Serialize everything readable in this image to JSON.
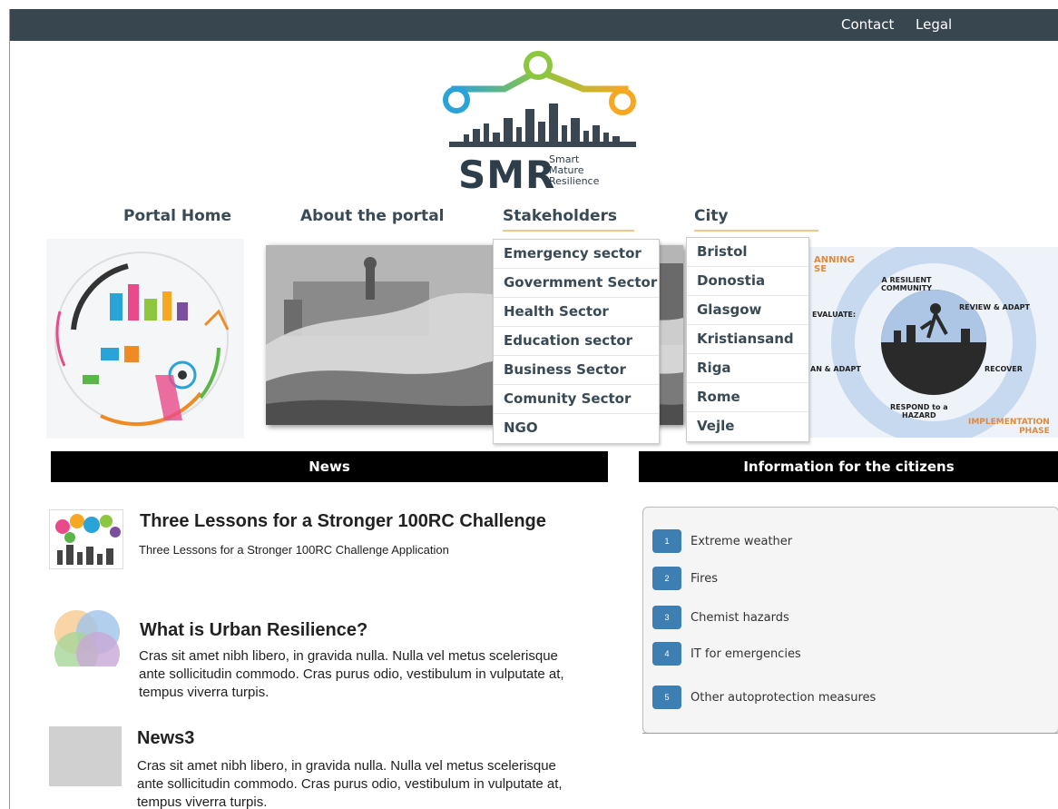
{
  "topnav": {
    "contact": "Contact",
    "legal": "Legal"
  },
  "logo": {
    "word": "SMR",
    "sub1": "Smart",
    "sub2": "Mature",
    "sub3": "Resilience"
  },
  "nav": {
    "portal_home": "Portal Home",
    "about": "About the portal",
    "stakeholders": "Stakeholders",
    "city": "City"
  },
  "stakeholders_menu": [
    "Emergency sector",
    "Govermment Sector",
    "Health Sector",
    "Education sector",
    "Business Sector",
    "Comunity Sector",
    "NGO"
  ],
  "city_menu": [
    "Bristol",
    "Donostia",
    "Glasgow",
    "Kristiansand",
    "Riga",
    "Rome",
    "Vejle"
  ],
  "banner_right": {
    "planning": "ANNING",
    "planning_sub": "SE",
    "resilient": "A RESILIENT",
    "community": "COMMUNITY",
    "evaluate": "EVALUATE:",
    "review": "REVIEW & ADAPT",
    "plan": "AN & ADAPT",
    "recover": "RECOVER",
    "respond": "RESPOND to a",
    "hazard": "HAZARD",
    "implementation": "IMPLEMENTATION",
    "phase": "PHASE"
  },
  "news": {
    "heading": "News",
    "items": [
      {
        "title": "Three Lessons for a Stronger 100RC Challenge",
        "text": "Three Lessons for a Stronger 100RC Challenge Application"
      },
      {
        "title": "What is Urban Resilience?",
        "text": "Cras sit amet nibh libero, in gravida nulla. Nulla vel metus scelerisque ante sollicitudin commodo. Cras purus odio, vestibulum in vulputate at, tempus viverra turpis."
      },
      {
        "title": "News3",
        "text": "Cras sit amet nibh libero, in gravida nulla. Nulla vel metus scelerisque ante sollicitudin commodo. Cras purus odio, vestibulum in vulputate at, tempus viverra turpis."
      }
    ]
  },
  "info": {
    "heading": "Information for the citizens",
    "items": [
      {
        "num": "1",
        "label": "Extreme weather"
      },
      {
        "num": "2",
        "label": "Fires"
      },
      {
        "num": "3",
        "label": "Chemist hazards"
      },
      {
        "num": "4",
        "label": "IT for emergencies"
      },
      {
        "num": "5",
        "label": "Other autoprotection measures"
      }
    ]
  },
  "colors": {
    "topbar": "#38464f",
    "accent": "#f3c58a",
    "badge": "#3e7fb3",
    "logo_blue": "#2aa3d8",
    "logo_green": "#8dc63f",
    "logo_orange": "#f7a823"
  }
}
